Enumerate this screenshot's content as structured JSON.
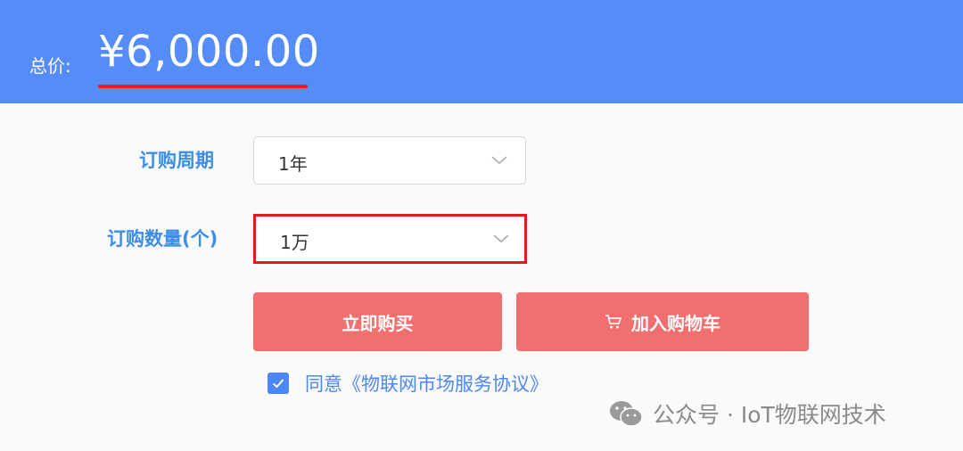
{
  "header": {
    "price_label": "总价:",
    "price_value": "¥6,000.00",
    "colors": {
      "background": "#568cf8",
      "underline": "#e81c1c"
    }
  },
  "form": {
    "period": {
      "label": "订购周期",
      "value": "1年"
    },
    "quantity": {
      "label": "订购数量(个)",
      "value": "1万"
    }
  },
  "actions": {
    "buy_now": "立即购买",
    "add_to_cart": "加入购物车",
    "cart_icon": "cart-icon",
    "button_color": "#f26f6f"
  },
  "agreement": {
    "checked": true,
    "prefix": "同意",
    "link": "《物联网市场服务协议》"
  },
  "watermark": {
    "icon": "wechat-icon",
    "text": "公众号 · IoT物联网技术"
  }
}
